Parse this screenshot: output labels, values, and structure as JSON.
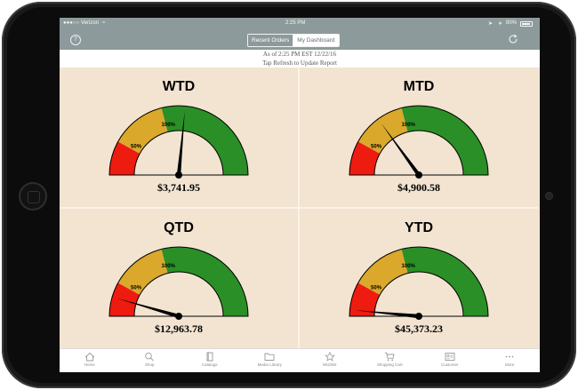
{
  "status": {
    "carrier": "Verizon",
    "time": "2:25 PM",
    "battery": "80%"
  },
  "nav": {
    "help_glyph": "?",
    "tabs": [
      {
        "label": "Recent Orders"
      },
      {
        "label": "My Dashboard"
      }
    ],
    "selected_tab": "My Dashboard"
  },
  "info": {
    "line1": "As of 2:25 PM EST 12/22/16",
    "line2": "Tap Refresh to Update Report"
  },
  "gauges": [
    {
      "title": "WTD",
      "amount": "$3,741.95",
      "marks": [
        "50%",
        "100%"
      ],
      "needle_fraction": 0.53
    },
    {
      "title": "MTD",
      "amount": "$4,900.58",
      "marks": [
        "50%",
        "100%"
      ],
      "needle_fraction": 0.3
    },
    {
      "title": "QTD",
      "amount": "$12,963.78",
      "marks": [
        "50%",
        "100%"
      ],
      "needle_fraction": 0.09
    },
    {
      "title": "YTD",
      "amount": "$45,373.23",
      "marks": [
        "50%",
        "100%"
      ],
      "needle_fraction": 0.03
    }
  ],
  "colors": {
    "red": "#ee1b10",
    "amber": "#daa82b",
    "green": "#2a8f26",
    "panel": "#f2e4d1",
    "bar": "#8d9a9b"
  },
  "tabbar": [
    {
      "label": "Home",
      "icon": "home-icon"
    },
    {
      "label": "Shop",
      "icon": "search-icon"
    },
    {
      "label": "Catalogs",
      "icon": "book-icon"
    },
    {
      "label": "Media Library",
      "icon": "folder-icon"
    },
    {
      "label": "Wishlist",
      "icon": "star-icon"
    },
    {
      "label": "Shopping Cart",
      "icon": "cart-icon"
    },
    {
      "label": "Customer",
      "icon": "id-card-icon"
    },
    {
      "label": "More",
      "icon": "more-icon"
    }
  ]
}
